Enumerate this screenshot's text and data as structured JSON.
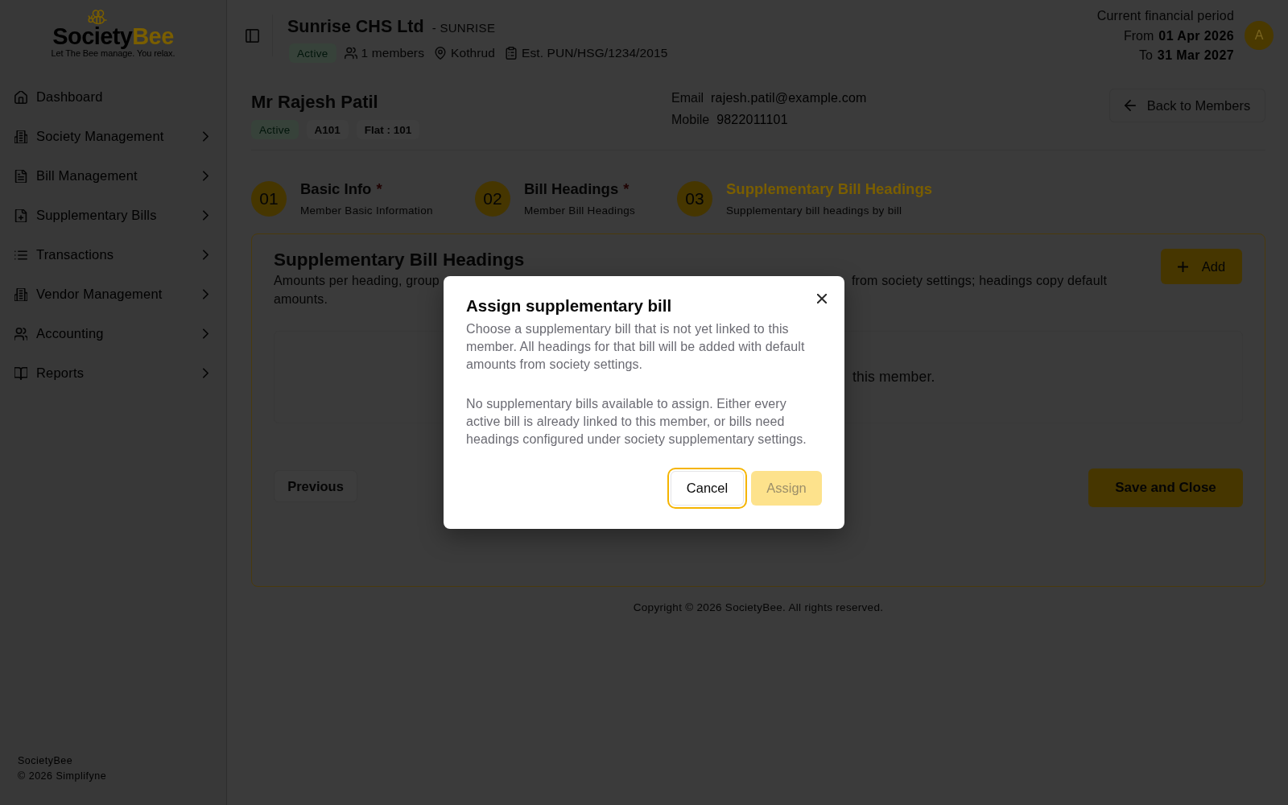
{
  "sidebar": {
    "logo": {
      "wordmark_dark": "Society",
      "wordmark_accent": "Bee",
      "tagline": "Let The Bee manage. You relax."
    },
    "items": [
      {
        "label": "Dashboard",
        "has_submenu": false
      },
      {
        "label": "Society Management",
        "has_submenu": true
      },
      {
        "label": "Bill Management",
        "has_submenu": true
      },
      {
        "label": "Supplementary Bills",
        "has_submenu": true
      },
      {
        "label": "Transactions",
        "has_submenu": true
      },
      {
        "label": "Vendor Management",
        "has_submenu": true
      },
      {
        "label": "Accounting",
        "has_submenu": true
      },
      {
        "label": "Reports",
        "has_submenu": true
      }
    ],
    "footer": {
      "brand": "SocietyBee",
      "copyright": "© 2026 Simplifyne"
    }
  },
  "header": {
    "society_name": "Sunrise CHS Ltd",
    "society_code": "- SUNRISE",
    "status": "Active",
    "members": "1 members",
    "locality": "Kothrud",
    "registration": "Est. PUN/HSG/1234/2015",
    "financial_period": {
      "title": "Current financial period",
      "from_label": "From",
      "from_date": "01 Apr 2026",
      "to_label": "To",
      "to_date": "31 Mar 2027"
    },
    "avatar_initial": "A"
  },
  "member": {
    "name": "Mr Rajesh Patil",
    "badges": [
      {
        "text": "Active",
        "kind": "status"
      },
      {
        "text": "A101",
        "kind": "plain"
      },
      {
        "text": "Flat : 101",
        "kind": "plain"
      }
    ],
    "contacts": [
      {
        "label": "Email",
        "value": "rajesh.patil@example.com"
      },
      {
        "label": "Mobile",
        "value": "9822011101"
      }
    ],
    "back_button": "Back to Members"
  },
  "steps": [
    {
      "number": "01",
      "title": "Basic Info",
      "required_mark": "*",
      "subtitle": "Member Basic Information",
      "selected": false
    },
    {
      "number": "02",
      "title": "Bill Headings",
      "required_mark": "*",
      "subtitle": "Member Bill Headings",
      "selected": false
    },
    {
      "number": "03",
      "title": "Supplementary Bill Headings",
      "subtitle": "Supplementary bill headings by bill",
      "selected": true
    }
  ],
  "card": {
    "title": "Supplementary Bill Headings",
    "description_parts": [
      "Amounts per heading, group",
      "from society settings; headings copy default",
      "amounts."
    ],
    "add_button": "Add",
    "empty_state_part": "this member.",
    "previous_button": "Previous",
    "save_button": "Save and Close"
  },
  "footer": {
    "copyright": "Copyright © 2026 SocietyBee. All rights reserved."
  },
  "dialog": {
    "title": "Assign supplementary bill",
    "paragraphs": [
      "Choose a supplementary bill that is not yet linked to this member. All headings for that bill will be added with default amounts from society settings.",
      "No supplementary bills available to assign. Either every active bill is already linked to this member, or bills need headings configured under society supplementary settings."
    ],
    "buttons": [
      {
        "label": "Cancel",
        "kind": "secondary",
        "focused": true,
        "disabled": false
      },
      {
        "label": "Assign",
        "kind": "primary",
        "focused": false,
        "disabled": true
      }
    ]
  }
}
